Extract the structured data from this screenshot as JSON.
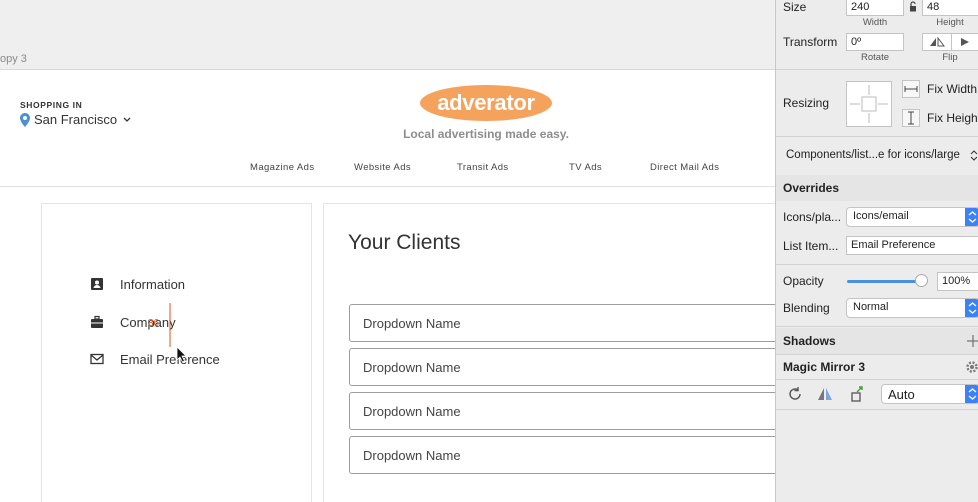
{
  "canvas": {
    "artboard_label": "opy 3",
    "header": {
      "shopping_in_label": "SHOPPING IN",
      "city": "San Francisco",
      "logo_text": "adverator",
      "tagline": "Local advertising made easy.",
      "nav": [
        "Magazine Ads",
        "Website Ads",
        "Transit Ads",
        "TV Ads",
        "Direct Mail Ads"
      ]
    },
    "sidebar": {
      "items": [
        {
          "label": "Information",
          "icon": "contact-card-icon"
        },
        {
          "label": "Company",
          "icon": "briefcase-icon"
        },
        {
          "label": "Email Preference",
          "icon": "envelope-icon"
        }
      ],
      "measure_value": "36"
    },
    "main": {
      "title": "Your Clients",
      "dropdowns": [
        "Dropdown Name",
        "Dropdown Name",
        "Dropdown Name",
        "Dropdown Name"
      ]
    },
    "colors": {
      "logo_orange": "#f5a25d",
      "measure_red": "#d9531e"
    }
  },
  "inspector": {
    "size_label": "Size",
    "width_value": "240",
    "height_value": "48",
    "width_caption": "Width",
    "height_caption": "Height",
    "transform_label": "Transform",
    "rotate_value": "0º",
    "rotate_caption": "Rotate",
    "flip_caption": "Flip",
    "resizing_label": "Resizing",
    "fix_width_label": "Fix Width",
    "fix_height_label": "Fix Height",
    "symbol_name": "Components/list...e for icons/large",
    "overrides_label": "Overrides",
    "override_icons_label": "Icons/pla...",
    "override_icons_value": "Icons/email",
    "override_list_label": "List Item...",
    "override_list_value": "Email Preference",
    "opacity_label": "Opacity",
    "opacity_value": "100%",
    "opacity_level": 1.0,
    "blending_label": "Blending",
    "blending_value": "Normal",
    "shadows_label": "Shadows",
    "plugin_label": "Magic Mirror 3",
    "plugin_mode": "Auto",
    "accent": "#3b82f6"
  }
}
